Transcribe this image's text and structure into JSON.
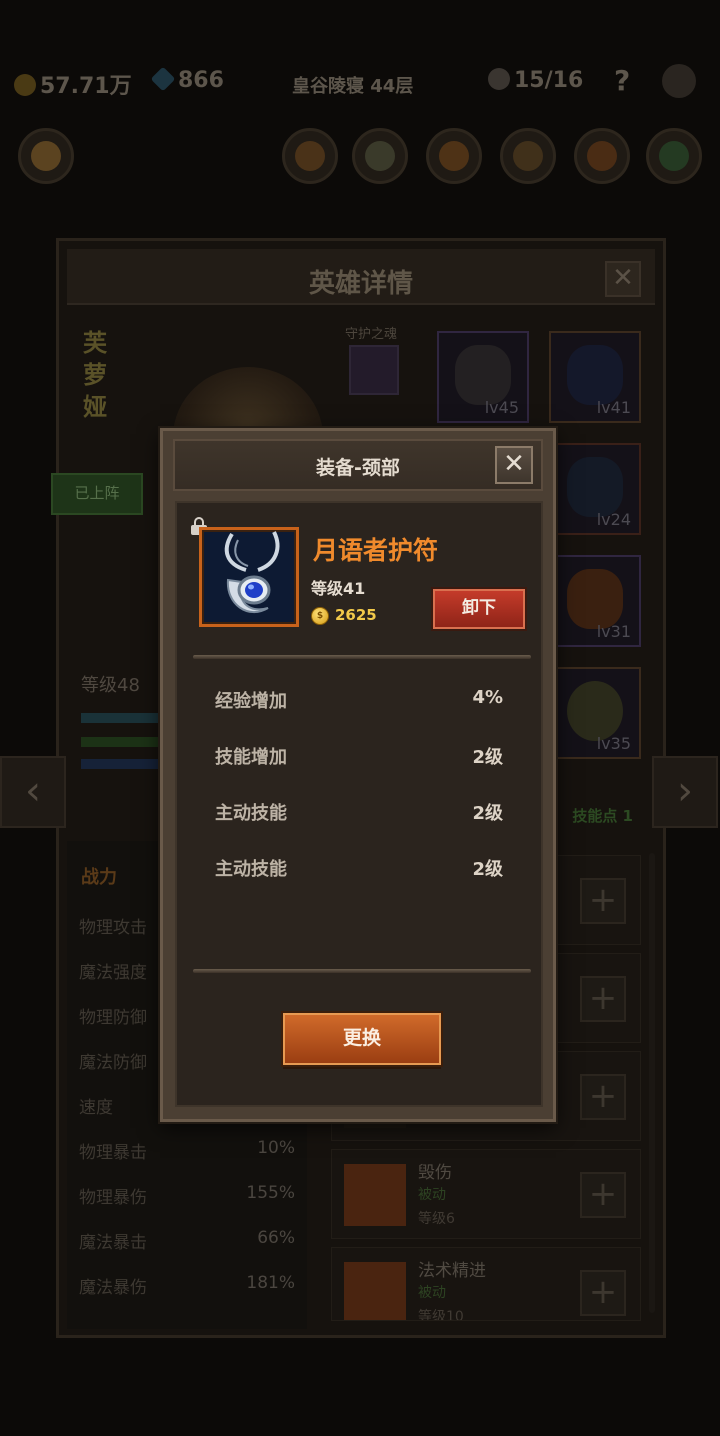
{
  "status_bar": {
    "gold": "57.71万",
    "gems": "866",
    "dungeon": "皇谷陵寝 44层",
    "skulls": "15/16",
    "help": "?"
  },
  "hero_detail": {
    "title": "英雄详情",
    "close": "✕",
    "hero_name": "芙萝娅",
    "guard_label": "守护之魂",
    "deployed": "已上阵",
    "level": "等级48",
    "equipment": [
      {
        "level": "lv45",
        "icon": "helmet-icon"
      },
      {
        "level": "lv41",
        "icon": "amulet-icon"
      },
      {
        "level": "lv24",
        "icon": "armor-icon"
      },
      {
        "level": "lv31",
        "icon": "ring-icon"
      },
      {
        "level": "lv35",
        "icon": "shield-icon"
      }
    ],
    "stats_header": "战力",
    "stats": [
      {
        "label": "物理攻击",
        "value": ""
      },
      {
        "label": "魔法强度",
        "value": ""
      },
      {
        "label": "物理防御",
        "value": ""
      },
      {
        "label": "魔法防御",
        "value": ""
      },
      {
        "label": "速度",
        "value": ""
      },
      {
        "label": "物理暴击",
        "value": "10%"
      },
      {
        "label": "物理暴伤",
        "value": "155%"
      },
      {
        "label": "魔法暴击",
        "value": "66%"
      },
      {
        "label": "魔法暴伤",
        "value": "181%"
      }
    ],
    "skill_points": "技能点 1",
    "skills": [
      {
        "name": "",
        "type": "",
        "level": ""
      },
      {
        "name": "",
        "type": "",
        "level": ""
      },
      {
        "name": "",
        "type": "",
        "level": ""
      },
      {
        "name": "毁伤",
        "type": "被动",
        "level": "等级6"
      },
      {
        "name": "法术精进",
        "type": "被动",
        "level": "等级10"
      }
    ],
    "plus": "+",
    "prev": "‹",
    "next": "›"
  },
  "modal": {
    "title": "装备-颈部",
    "close": "✕",
    "item": {
      "name": "月语者护符",
      "level": "等级41",
      "price": "2625",
      "coin_symbol": "$",
      "icon": "moon-amulet-icon",
      "locked": true
    },
    "unequip_label": "卸下",
    "attributes": [
      {
        "label": "经验增加",
        "value": "4%"
      },
      {
        "label": "技能增加",
        "value": "2级"
      },
      {
        "label": "主动技能",
        "value": "2级"
      },
      {
        "label": "主动技能",
        "value": "2级"
      }
    ],
    "replace_label": "更换"
  },
  "colors": {
    "item_name": "#f08a2c",
    "coin": "#f2c94a",
    "unequip_button": "#c43b2a",
    "replace_button": "#d06a2a",
    "passive_green": "#2d4322"
  }
}
